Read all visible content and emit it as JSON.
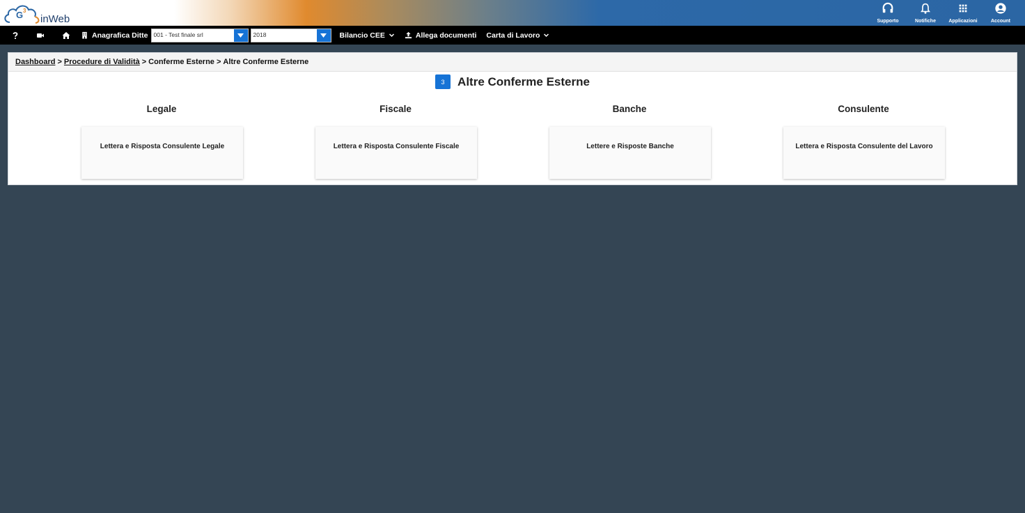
{
  "app": {
    "logo_text": "inWeb"
  },
  "top_actions": [
    {
      "label": "Supporto",
      "icon": "headset-icon"
    },
    {
      "label": "Notifiche",
      "icon": "bell-icon"
    },
    {
      "label": "Applicazioni",
      "icon": "grid-icon"
    },
    {
      "label": "Account",
      "icon": "user-circle-icon"
    }
  ],
  "navbar": {
    "help_icon": "question-icon",
    "video_icon": "video-camera-icon",
    "home_icon": "home-icon",
    "anagrafica_label": "Anagrafica Ditte",
    "company_select_value": "001 - Test finale srl",
    "year_select_value": "2018",
    "bilancio_label": "Bilancio CEE",
    "allega_label": "Allega documenti",
    "carta_label": "Carta di Lavoro"
  },
  "breadcrumb": {
    "items": [
      "Dashboard",
      "Procedure di Validità",
      "Conferme Esterne",
      "Altre Conferme Esterne"
    ],
    "separator": ">"
  },
  "page": {
    "badge": "3",
    "title": "Altre Conferme Esterne"
  },
  "columns": [
    {
      "title": "Legale",
      "card": "Lettera e Risposta Consulente Legale"
    },
    {
      "title": "Fiscale",
      "card": "Lettera e Risposta Consulente Fiscale"
    },
    {
      "title": "Banche",
      "card": "Lettere e Risposte Banche"
    },
    {
      "title": "Consulente",
      "card": "Lettera e Risposta Consulente del Lavoro"
    }
  ],
  "colors": {
    "accent": "#1673d6",
    "background": "#344554",
    "navbar": "#000000",
    "header_blue": "#2b66a4",
    "header_orange": "#e08a2e"
  }
}
